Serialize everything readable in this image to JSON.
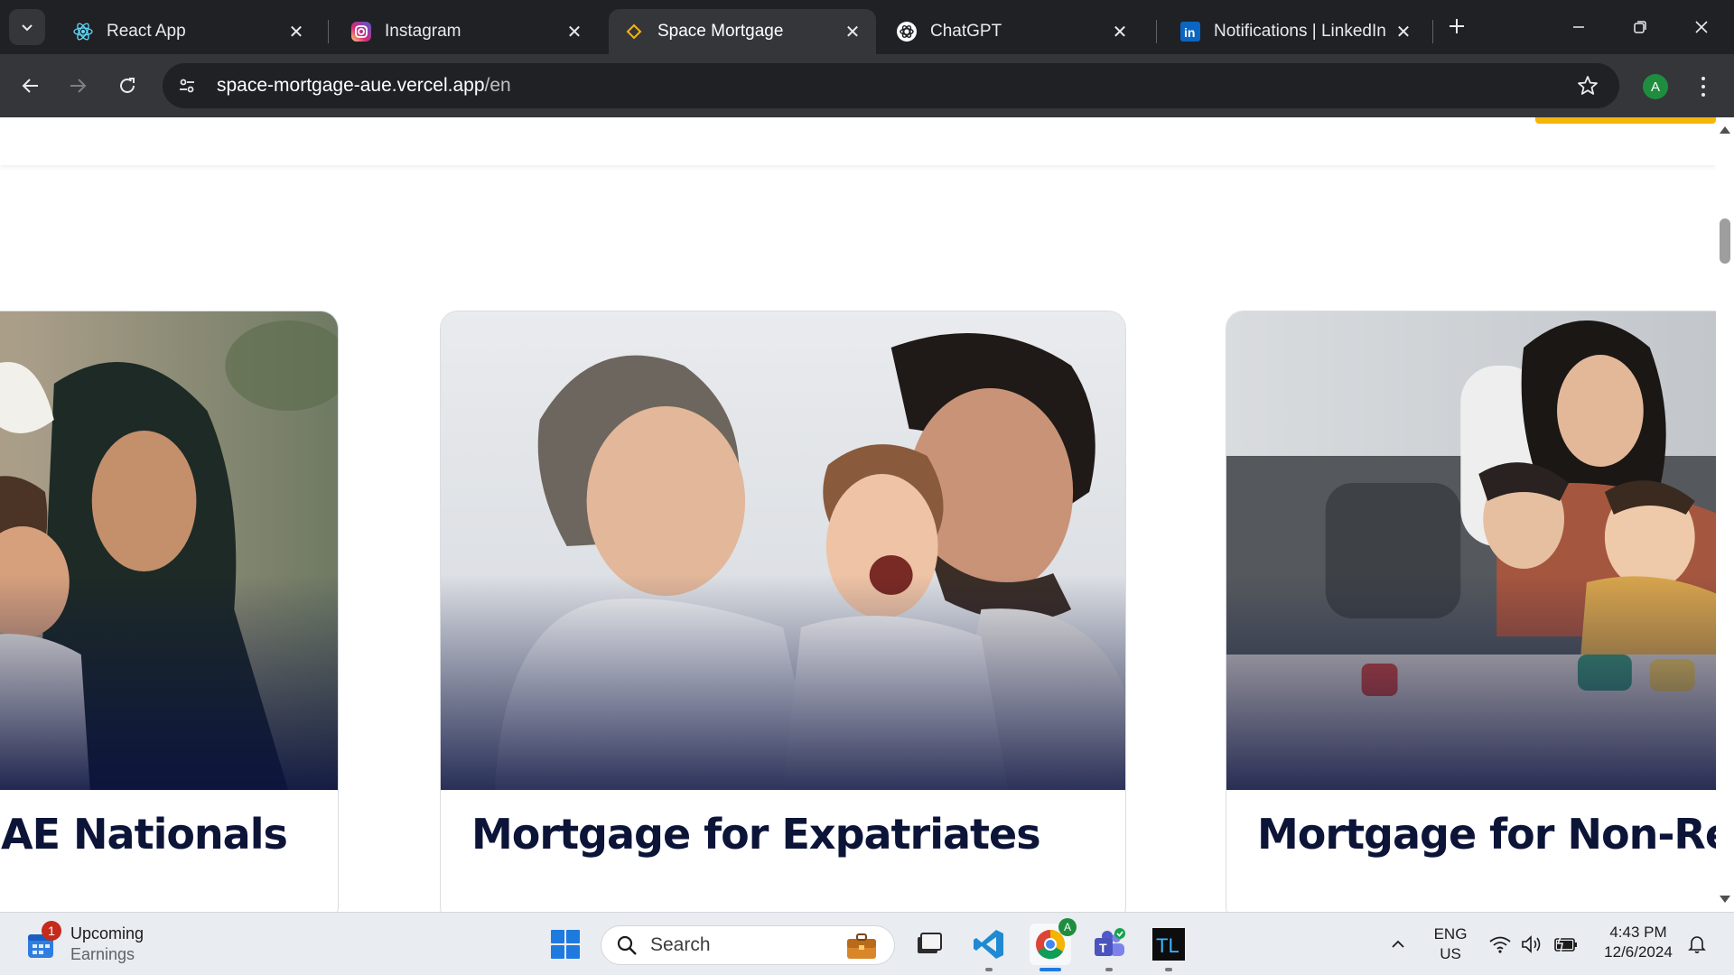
{
  "browser": {
    "tabs": [
      {
        "title": "React App",
        "icon": "react-icon"
      },
      {
        "title": "Instagram",
        "icon": "instagram-icon"
      },
      {
        "title": "Space Mortgage",
        "icon": "space-mortgage-icon",
        "active": true
      },
      {
        "title": "ChatGPT",
        "icon": "chatgpt-icon"
      },
      {
        "title": "Notifications | LinkedIn",
        "icon": "linkedin-icon"
      }
    ],
    "url": {
      "host": "space-mortgage-aue.vercel.app",
      "path": "/en"
    },
    "profile_initial": "A",
    "colors": {
      "tabstrip": "#202124",
      "toolbar": "#35363a",
      "omnibox": "#202124"
    }
  },
  "page": {
    "cards": [
      {
        "title": "AE Nationals",
        "image": "family-photo-uae-nationals"
      },
      {
        "title": "Mortgage for Expatriates",
        "image": "family-photo-expatriates"
      },
      {
        "title": "Mortgage for Non-Res",
        "image": "family-photo-non-residents"
      }
    ],
    "colors": {
      "title": "#0c1438",
      "accent": "#f5b60b",
      "card_border": "#dadce0"
    }
  },
  "taskbar": {
    "widget": {
      "title": "Upcoming",
      "subtitle": "Earnings",
      "badge": "1"
    },
    "search_placeholder": "Search",
    "language": {
      "line1": "ENG",
      "line2": "US"
    },
    "clock": {
      "time": "4:43 PM",
      "date": "12/6/2024"
    },
    "chrome_badge": "A"
  }
}
